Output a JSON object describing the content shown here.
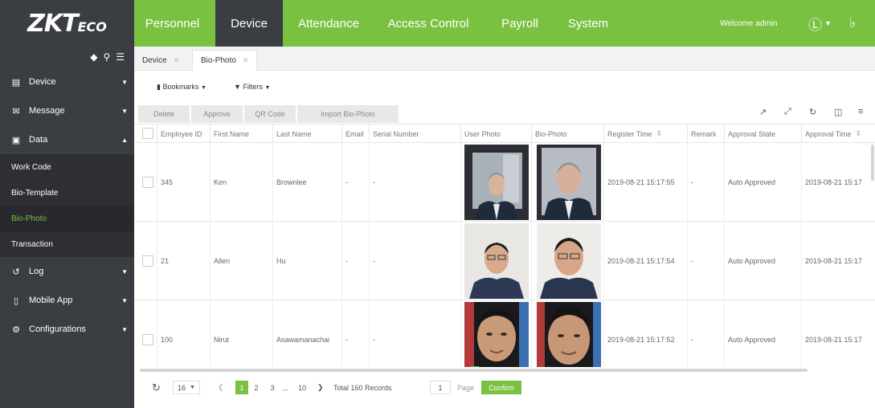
{
  "brand": {
    "logo_main": "ZKT",
    "logo_sub": "ECO"
  },
  "nav": {
    "items": [
      {
        "label": "Personnel",
        "active": false
      },
      {
        "label": "Device",
        "active": true
      },
      {
        "label": "Attendance",
        "active": false
      },
      {
        "label": "Access Control",
        "active": false
      },
      {
        "label": "Payroll",
        "active": false
      },
      {
        "label": "System",
        "active": false
      }
    ],
    "welcome": "Welcome admin"
  },
  "sidebar": {
    "top_items": [
      {
        "label": "Device",
        "icon": "devices-icon"
      },
      {
        "label": "Message",
        "icon": "message-icon"
      },
      {
        "label": "Data",
        "icon": "data-icon"
      }
    ],
    "sub_items": [
      {
        "label": "Work Code",
        "active": false
      },
      {
        "label": "Bio-Template",
        "active": false
      },
      {
        "label": "Bio-Photo",
        "active": true
      },
      {
        "label": "Transaction",
        "active": false
      }
    ],
    "bottom_items": [
      {
        "label": "Log",
        "icon": "log-icon"
      },
      {
        "label": "Mobile App",
        "icon": "mobile-icon"
      },
      {
        "label": "Configurations",
        "icon": "gear-icon"
      }
    ]
  },
  "tabs": [
    {
      "label": "Device"
    },
    {
      "label": "Bio-Photo"
    }
  ],
  "filters": {
    "bookmarks": "Bookmarks",
    "filters": "Filters"
  },
  "toolbar": {
    "delete": "Delete",
    "approve": "Approve",
    "qr_code": "QR Code",
    "import": "Import Bio-Photo"
  },
  "table": {
    "headers": [
      "Employee ID",
      "First Name",
      "Last Name",
      "Email",
      "Serial Number",
      "User Photo",
      "Bio-Photo",
      "Register Time",
      "Remark",
      "Approval State",
      "Approval Time"
    ],
    "rows": [
      {
        "employee_id": "345",
        "first_name": "Ken",
        "last_name": "Brownlee",
        "email": "-",
        "serial": "-",
        "register_time": "2019-08-21 15:17:55",
        "remark": "-",
        "approval_state": "Auto Approved",
        "approval_time": "2019-08-21 15:17"
      },
      {
        "employee_id": "21",
        "first_name": "Allen",
        "last_name": "Hu",
        "email": "-",
        "serial": "-",
        "register_time": "2019-08-21 15:17:54",
        "remark": "-",
        "approval_state": "Auto Approved",
        "approval_time": "2019-08-21 15:17"
      },
      {
        "employee_id": "100",
        "first_name": "Nirut",
        "last_name": "Asawamanachai",
        "email": "-",
        "serial": "-",
        "register_time": "2019-08-21 15:17:52",
        "remark": "-",
        "approval_state": "Auto Approved",
        "approval_time": "2019-08-21 15:17"
      }
    ]
  },
  "pager": {
    "page_size": "16",
    "pages": [
      "1",
      "2",
      "3",
      "...",
      "10"
    ],
    "total": "Total 160 Records",
    "page_input": "1",
    "page_label": "Page",
    "confirm": "Confirm"
  },
  "colors": {
    "accent": "#7ac142",
    "dark": "#3a3d42"
  }
}
